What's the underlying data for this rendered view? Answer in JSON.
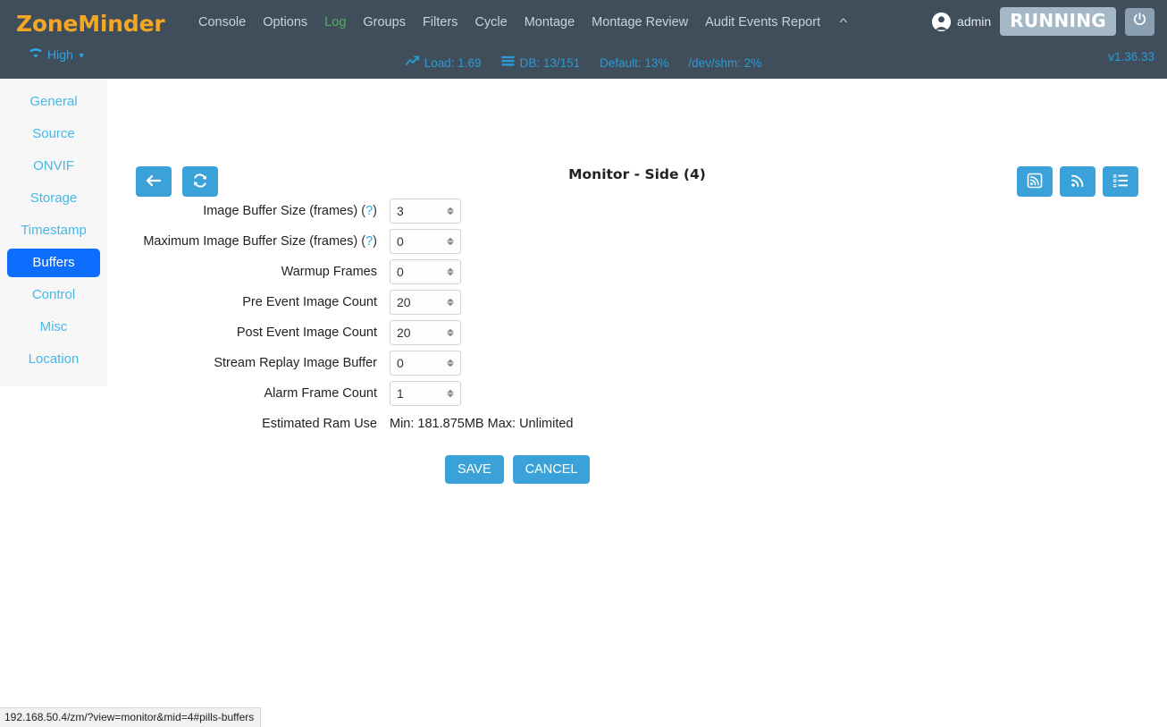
{
  "header": {
    "brand": "ZoneMinder",
    "bandwidth": {
      "label": "High",
      "icon": "wifi-icon",
      "caret": "▼"
    },
    "nav_items": [
      {
        "label": "Console",
        "active": false
      },
      {
        "label": "Options",
        "active": false
      },
      {
        "label": "Log",
        "active": true
      },
      {
        "label": "Groups",
        "active": false
      },
      {
        "label": "Filters",
        "active": false
      },
      {
        "label": "Cycle",
        "active": false
      },
      {
        "label": "Montage",
        "active": false
      },
      {
        "label": "Montage Review",
        "active": false
      },
      {
        "label": "Audit Events Report",
        "active": false
      }
    ],
    "nav_collapse_icon": "chevron-up-icon",
    "user": "admin",
    "user_icon": "user-circle-icon",
    "state_badge": "RUNNING",
    "power_icon": "power-icon",
    "version": "v1.36.33",
    "accent_green": "#51b063",
    "brand_color": "#f5a623",
    "bar_color": "#3f4e5a"
  },
  "status": {
    "items": [
      {
        "icon": "trending-up-icon",
        "label": "Load: 1.69"
      },
      {
        "icon": "database-icon",
        "label": "DB: 13/151"
      },
      {
        "icon": "",
        "label": "Default: 13%"
      },
      {
        "icon": "",
        "label": "/dev/shm: 2%"
      }
    ],
    "link_color": "#2b9ad6"
  },
  "sidebar": {
    "items": [
      {
        "label": "General",
        "active": false
      },
      {
        "label": "Source",
        "active": false
      },
      {
        "label": "ONVIF",
        "active": false
      },
      {
        "label": "Storage",
        "active": false
      },
      {
        "label": "Timestamp",
        "active": false
      },
      {
        "label": "Buffers",
        "active": true
      },
      {
        "label": "Control",
        "active": false
      },
      {
        "label": "Misc",
        "active": false
      },
      {
        "label": "Location",
        "active": false
      }
    ],
    "active_bg": "#0d6efd",
    "link_color": "#46b8e9"
  },
  "main": {
    "title": "Monitor - Side (4)",
    "toolbar_left": [
      {
        "icon": "back-arrow-icon",
        "name": "back-button"
      },
      {
        "icon": "refresh-icon",
        "name": "refresh-button"
      }
    ],
    "toolbar_right": [
      {
        "icon": "rss-square-icon",
        "name": "rss-square-button"
      },
      {
        "icon": "rss-icon",
        "name": "rss-button"
      },
      {
        "icon": "list-ol-icon",
        "name": "list-button"
      }
    ],
    "accent": "#3ba2d9",
    "fields": [
      {
        "label": "Image Buffer Size (frames)",
        "help": true,
        "value": "3",
        "name": "image-buffer-size"
      },
      {
        "label": "Maximum Image Buffer Size (frames)",
        "help": true,
        "value": "0",
        "name": "max-image-buffer-size"
      },
      {
        "label": "Warmup Frames",
        "help": false,
        "value": "0",
        "name": "warmup-frames"
      },
      {
        "label": "Pre Event Image Count",
        "help": false,
        "value": "20",
        "name": "pre-event-image-count"
      },
      {
        "label": "Post Event Image Count",
        "help": false,
        "value": "20",
        "name": "post-event-image-count"
      },
      {
        "label": "Stream Replay Image Buffer",
        "help": false,
        "value": "0",
        "name": "stream-replay-image-buffer"
      },
      {
        "label": "Alarm Frame Count",
        "help": false,
        "value": "1",
        "name": "alarm-frame-count"
      }
    ],
    "ram_label": "Estimated Ram Use",
    "ram_value": "Min: 181.875MB Max: Unlimited",
    "save_label": "SAVE",
    "cancel_label": "CANCEL"
  },
  "footer": {
    "url": "192.168.50.4/zm/?view=monitor&mid=4#pills-buffers"
  }
}
